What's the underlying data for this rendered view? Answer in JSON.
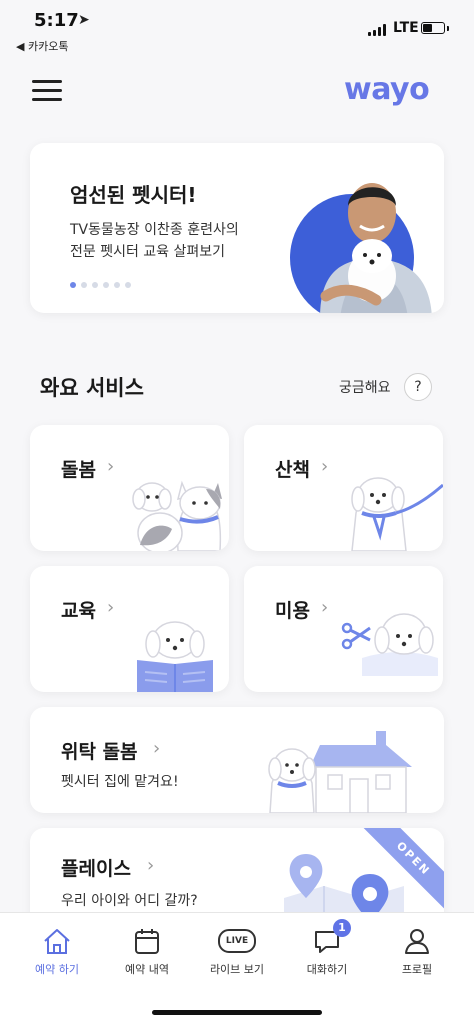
{
  "status_bar": {
    "time": "5:17",
    "back_label": "◀ 카카오톡",
    "network": "LTE",
    "battery_level": 0.45
  },
  "header": {
    "logo": "wayo",
    "menu_icon": "hamburger-menu-icon"
  },
  "banner": {
    "title": "엄선된 펫시터!",
    "subtitle_line1": "TV동물농장 이찬종 훈련사의",
    "subtitle_line2": "전문 펫시터 교육 살펴보기",
    "page_count": 6,
    "active_page": 1
  },
  "services": {
    "title": "와요 서비스",
    "faq_label": "궁금해요",
    "faq_button": "?",
    "cards": [
      {
        "title": "돌봄",
        "chevron": "›"
      },
      {
        "title": "산책",
        "chevron": "›"
      },
      {
        "title": "교육",
        "chevron": "›"
      },
      {
        "title": "미용",
        "chevron": "›"
      },
      {
        "title": "위탁 돌봄",
        "chevron": "›",
        "subtitle": "펫시터 집에 맡겨요!"
      },
      {
        "title": "플레이스",
        "chevron": "›",
        "subtitle": "우리 아이와 어디 갈까?",
        "badge": "OPEN"
      }
    ]
  },
  "tabbar": {
    "tabs": [
      {
        "label": "예약 하기",
        "icon": "home-icon",
        "active": true
      },
      {
        "label": "예약 내역",
        "icon": "calendar-icon",
        "active": false
      },
      {
        "label": "라이브 보기",
        "icon": "live-icon",
        "icon_text": "LIVE",
        "active": false
      },
      {
        "label": "대화하기",
        "icon": "chat-icon",
        "badge": "1",
        "active": false
      },
      {
        "label": "프로필",
        "icon": "profile-icon",
        "active": false
      }
    ]
  },
  "colors": {
    "accent": "#6777e6",
    "badge": "#5f73e6",
    "illustration_blue": "#7a8fe8"
  }
}
